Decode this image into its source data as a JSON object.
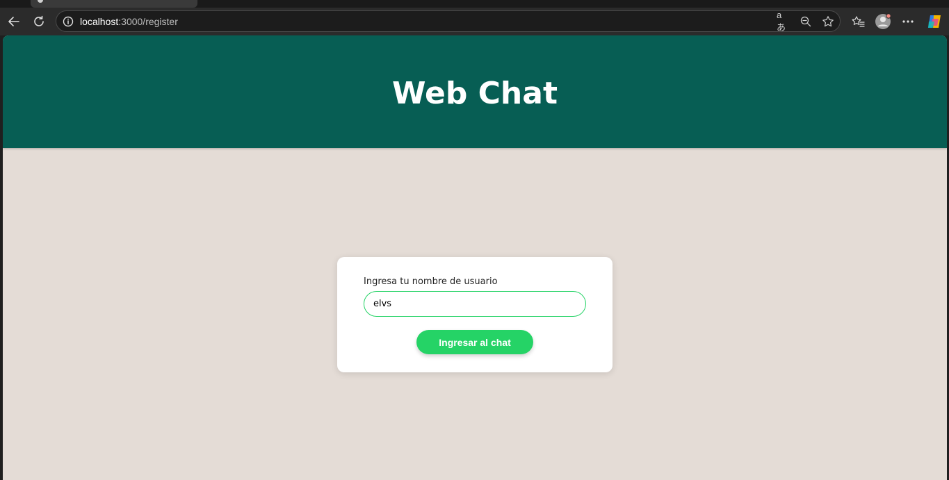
{
  "browser": {
    "url_host": "localhost",
    "url_path": ":3000/register",
    "icons": [
      "back-icon",
      "reload-icon",
      "info-icon",
      "read-aloud-icon",
      "zoom-out-icon",
      "favorite-star-icon",
      "favorites-icon",
      "profile-avatar-icon",
      "more-menu-icon",
      "copilot-icon"
    ],
    "read_aloud_text": "aあ"
  },
  "page": {
    "title": "Web Chat",
    "colors": {
      "header": "#075e54",
      "background": "#e4dcd6",
      "accent": "#25d366"
    }
  },
  "form": {
    "label": "Ingresa tu nombre de usuario",
    "username_value": "elvs",
    "submit_label": "Ingresar al chat"
  }
}
